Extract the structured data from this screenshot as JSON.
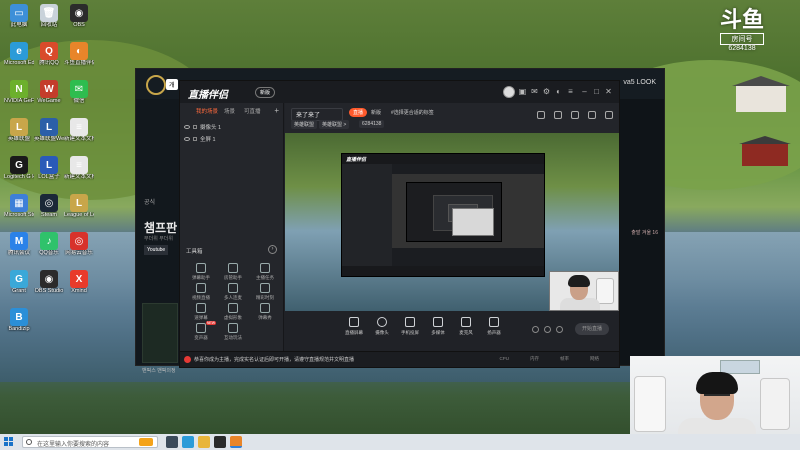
{
  "desktop": {
    "icons": [
      {
        "label": "此电脑",
        "color": "#3d8fd8",
        "glyph": "▭"
      },
      {
        "label": "回收站",
        "color": "#c9d2da",
        "glyph": "🗑"
      },
      {
        "label": "OBS",
        "color": "#2b2b2b",
        "glyph": "◉"
      },
      {
        "label": "Microsoft Edge",
        "color": "#2b9bd8",
        "glyph": "e"
      },
      {
        "label": "腾讯QQ",
        "color": "#d94b2b",
        "glyph": "Q"
      },
      {
        "label": "斗鱼直播伴侣",
        "color": "#e8852a",
        "glyph": "◐"
      },
      {
        "label": "NVIDIA GeForce Experience",
        "color": "#6cb02c",
        "glyph": "N"
      },
      {
        "label": "WeGame",
        "color": "#c43d2b",
        "glyph": "W"
      },
      {
        "label": "微信",
        "color": "#2ebd4f",
        "glyph": "✉"
      },
      {
        "label": "英雄联盟",
        "color": "#c8a64a",
        "glyph": "L"
      },
      {
        "label": "英雄联盟WeGame版",
        "color": "#2b5fa8",
        "glyph": "L"
      },
      {
        "label": "新建文本文档",
        "color": "#e8e8e8",
        "glyph": "≡"
      },
      {
        "label": "Logitech G HUB",
        "color": "#1a1a1a",
        "glyph": "G"
      },
      {
        "label": "LOL盒子",
        "color": "#2a5ab8",
        "glyph": "L"
      },
      {
        "label": "新建文本文档",
        "color": "#e8e8e8",
        "glyph": "≡"
      },
      {
        "label": "Microsoft Store",
        "color": "#3d7fd8",
        "glyph": "▦"
      },
      {
        "label": "Steam",
        "color": "#1b2838",
        "glyph": "◎"
      },
      {
        "label": "League of Legends",
        "color": "#c8a64a",
        "glyph": "L"
      },
      {
        "label": "腾讯会议",
        "color": "#2b82e8",
        "glyph": "M"
      },
      {
        "label": "QQ音乐",
        "color": "#2fc26b",
        "glyph": "♪"
      },
      {
        "label": "网易云音乐",
        "color": "#d8322b",
        "glyph": "◎"
      },
      {
        "label": "Grant",
        "color": "#3aa8d8",
        "glyph": "G"
      },
      {
        "label": "OBS Studio",
        "color": "#2b2b2b",
        "glyph": "◉"
      },
      {
        "label": "Xmind",
        "color": "#e83b2b",
        "glyph": "X"
      },
      {
        "label": "Bandizip",
        "color": "#2b8fd8",
        "glyph": "B"
      }
    ]
  },
  "watermark": {
    "logo": "斗鱼",
    "room_label": "房间号",
    "room_number": "6284138"
  },
  "lol_client": {
    "chip": "개",
    "side_text_top": "공식",
    "side_title": "챔프판",
    "side_text_small": "무더위 무더위",
    "youtube": "Youtube",
    "card_text": "밴픽스 밴픽의정",
    "right_text": "va5 LOOK",
    "right_small": "출발 겨울 16"
  },
  "app": {
    "logo": "直播伴侣",
    "version": "新版",
    "tabs": [
      "我的场景",
      "场景",
      "可直播"
    ],
    "sources": [
      "摄像头 1",
      "全屏 1"
    ],
    "tools_title": "工具箱",
    "tools": [
      {
        "label": "弹幕助手"
      },
      {
        "label": "房管助手"
      },
      {
        "label": "主播任务"
      },
      {
        "label": "视频直播"
      },
      {
        "label": "多人连麦"
      },
      {
        "label": "精彩时刻"
      },
      {
        "label": "速弹幕"
      },
      {
        "label": "虚拟形象"
      },
      {
        "label": "弹幕秀"
      },
      {
        "label": "变声器",
        "badge": "NEW"
      },
      {
        "label": "互动玩法"
      }
    ],
    "room_title": "来了来了",
    "live_tag": "直播",
    "top_links": [
      "新版",
      "#选择更合适的标签"
    ],
    "top_chips": [
      "英雄联盟",
      "英雄联盟 >",
      "6284138"
    ],
    "controls": [
      {
        "label": "直播屏幕"
      },
      {
        "label": "摄像头"
      },
      {
        "label": "手机投屏"
      },
      {
        "label": "多媒体"
      },
      {
        "label": "麦克风"
      },
      {
        "label": "扬声器"
      }
    ],
    "start_button": "开始直播",
    "status_message": "恭喜你成为主播，完成实名认证后即可开播，请遵守直播规范并文明直播",
    "status_stats": [
      "CPU",
      "内存",
      "帧率",
      "网络"
    ]
  },
  "nested_app": {
    "logo": "直播伴侣"
  },
  "taskbar": {
    "search_placeholder": "在这里输入你要搜索的内容",
    "apps": [
      {
        "name": "task-view",
        "color": "#3b4a5a"
      },
      {
        "name": "edge",
        "color": "#2b9bd8"
      },
      {
        "name": "explorer",
        "color": "#e8b53a"
      },
      {
        "name": "obs",
        "color": "#2b2b2b"
      },
      {
        "name": "douyu",
        "color": "#e8852a"
      }
    ]
  }
}
